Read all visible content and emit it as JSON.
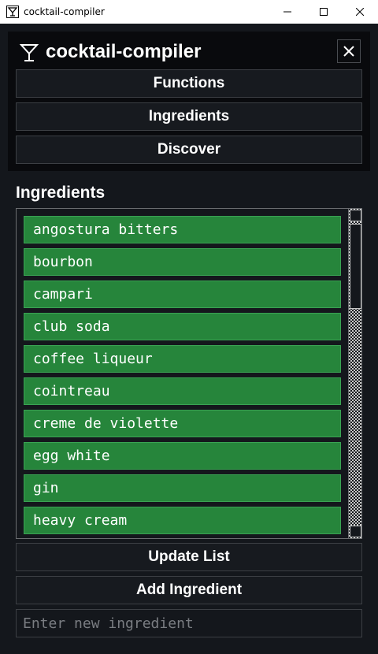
{
  "window": {
    "title": "cocktail-compiler"
  },
  "header": {
    "title": "cocktail-compiler"
  },
  "nav": [
    {
      "label": "Functions"
    },
    {
      "label": "Ingredients"
    },
    {
      "label": "Discover"
    }
  ],
  "section": {
    "heading": "Ingredients"
  },
  "ingredients": [
    "angostura bitters",
    "bourbon",
    "campari",
    "club soda",
    "coffee liqueur",
    "cointreau",
    "creme de violette",
    "egg white",
    "gin",
    "heavy cream"
  ],
  "actions": {
    "update_label": "Update List",
    "add_label": "Add Ingredient"
  },
  "input": {
    "placeholder": "Enter new ingredient",
    "value": ""
  },
  "colors": {
    "item_bg": "#26853b",
    "background": "#14171c",
    "panel": "#090a0d"
  },
  "icons": {
    "app": "cocktail-glass-icon",
    "close": "close-icon"
  }
}
